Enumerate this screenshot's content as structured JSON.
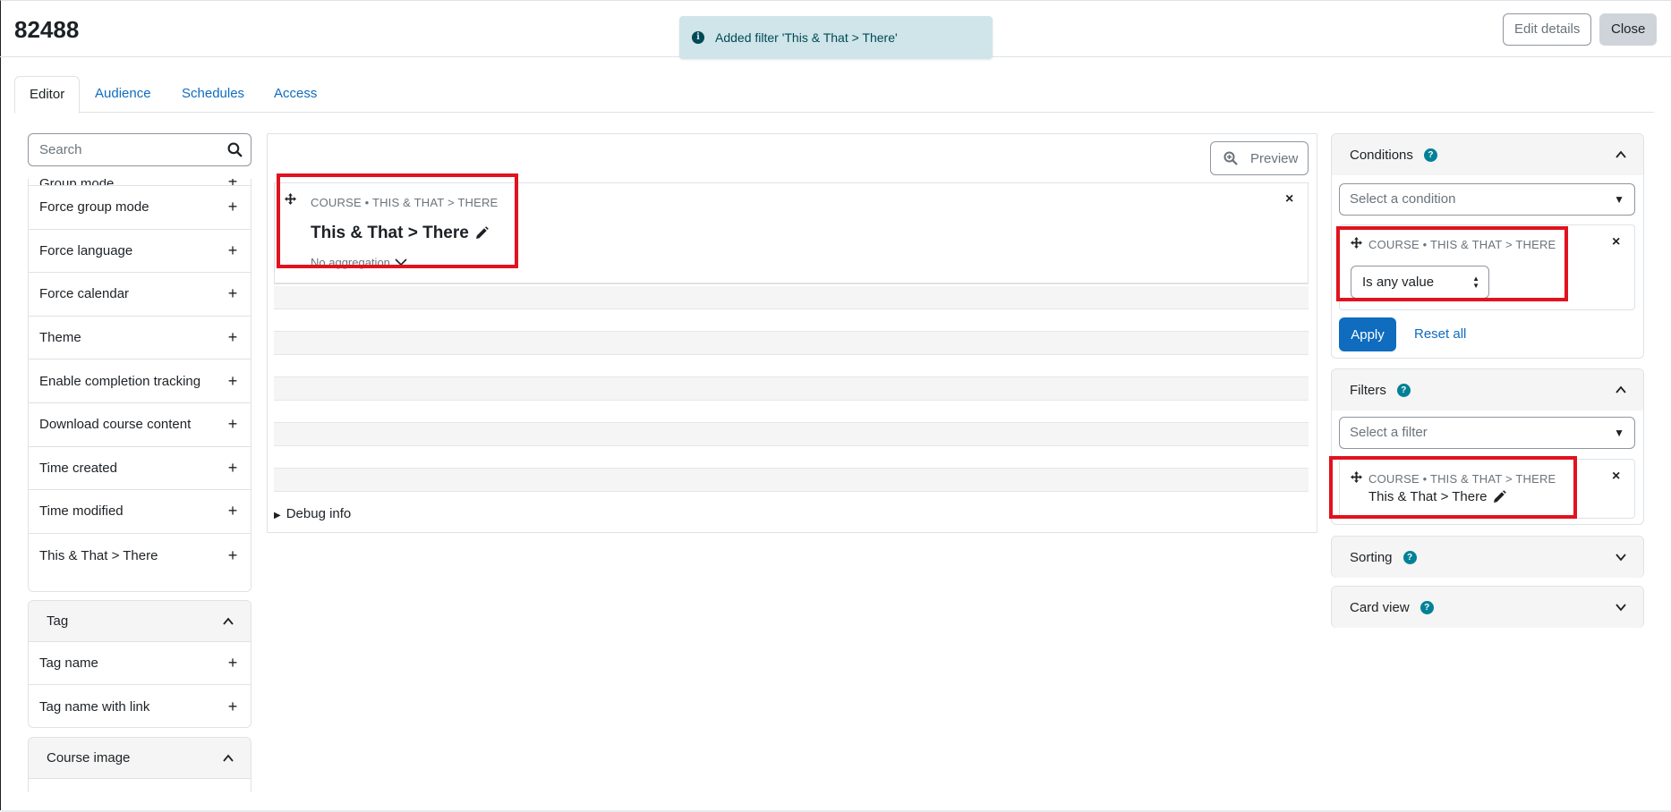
{
  "page": {
    "title": "82488"
  },
  "header": {
    "edit_details_label": "Edit details",
    "close_label": "Close"
  },
  "toast": {
    "message": "Added filter 'This & That > There'",
    "icon": "info-icon"
  },
  "tabs": [
    {
      "label": "Editor",
      "active": true
    },
    {
      "label": "Audience",
      "active": false
    },
    {
      "label": "Schedules",
      "active": false
    },
    {
      "label": "Access",
      "active": false
    }
  ],
  "sidebar": {
    "search": {
      "placeholder": "Search",
      "value": ""
    },
    "course_items": [
      {
        "label": "Group mode"
      },
      {
        "label": "Force group mode"
      },
      {
        "label": "Force language"
      },
      {
        "label": "Force calendar"
      },
      {
        "label": "Theme"
      },
      {
        "label": "Enable completion tracking"
      },
      {
        "label": "Download course content"
      },
      {
        "label": "Time created"
      },
      {
        "label": "Time modified"
      },
      {
        "label": "This & That > There"
      }
    ],
    "tag_section": {
      "title": "Tag",
      "items": [
        {
          "label": "Tag name"
        },
        {
          "label": "Tag name with link"
        }
      ]
    },
    "course_image_section": {
      "title": "Course image"
    }
  },
  "main": {
    "preview_label": "Preview",
    "column": {
      "meta": "COURSE • THIS & THAT > THERE",
      "title": "This & That > There",
      "aggregation": "No aggregation"
    },
    "debug_label": "Debug info"
  },
  "right": {
    "conditions": {
      "title": "Conditions",
      "select_placeholder": "Select a condition",
      "item_meta": "COURSE • THIS & THAT > THERE",
      "operator_value": "Is any value",
      "apply_label": "Apply",
      "reset_label": "Reset all"
    },
    "filters": {
      "title": "Filters",
      "select_placeholder": "Select a filter",
      "item_meta": "COURSE • THIS & THAT > THERE",
      "item_name": "This & That > There"
    },
    "sorting": {
      "title": "Sorting"
    },
    "card_view": {
      "title": "Card view"
    }
  },
  "colors": {
    "accent": "#0f6cbf",
    "highlight": "#e0131e",
    "toast_bg": "#cfe5e9",
    "help_icon": "#008196"
  }
}
